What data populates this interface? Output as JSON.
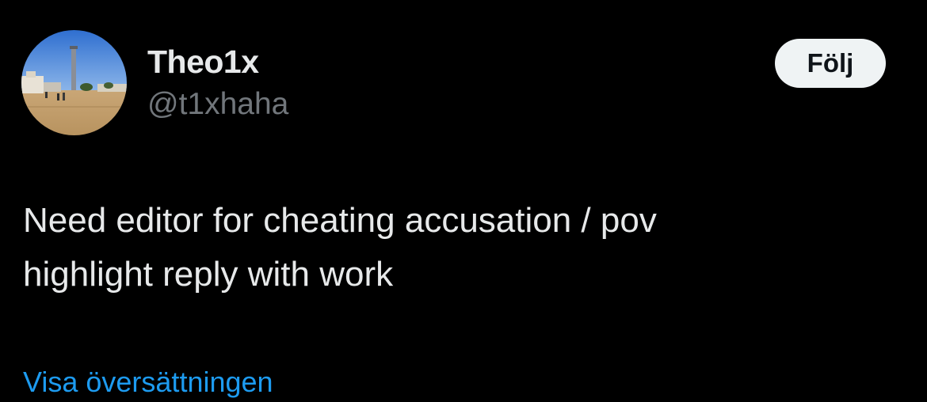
{
  "user": {
    "display_name": "Theo1x",
    "handle": "@t1xhaha",
    "avatar_icon": "profile-photo-avatar"
  },
  "actions": {
    "follow_label": "Följ"
  },
  "tweet": {
    "lines": [
      "Need editor for cheating accusation / pov",
      "highlight reply with work"
    ],
    "translate_label": "Visa översättningen"
  },
  "colors": {
    "background": "#000000",
    "primary_text": "#e7e9ea",
    "secondary_text": "#71767b",
    "link": "#1d9bf0",
    "follow_button_bg": "#eff3f4",
    "follow_button_text": "#0f1419"
  }
}
